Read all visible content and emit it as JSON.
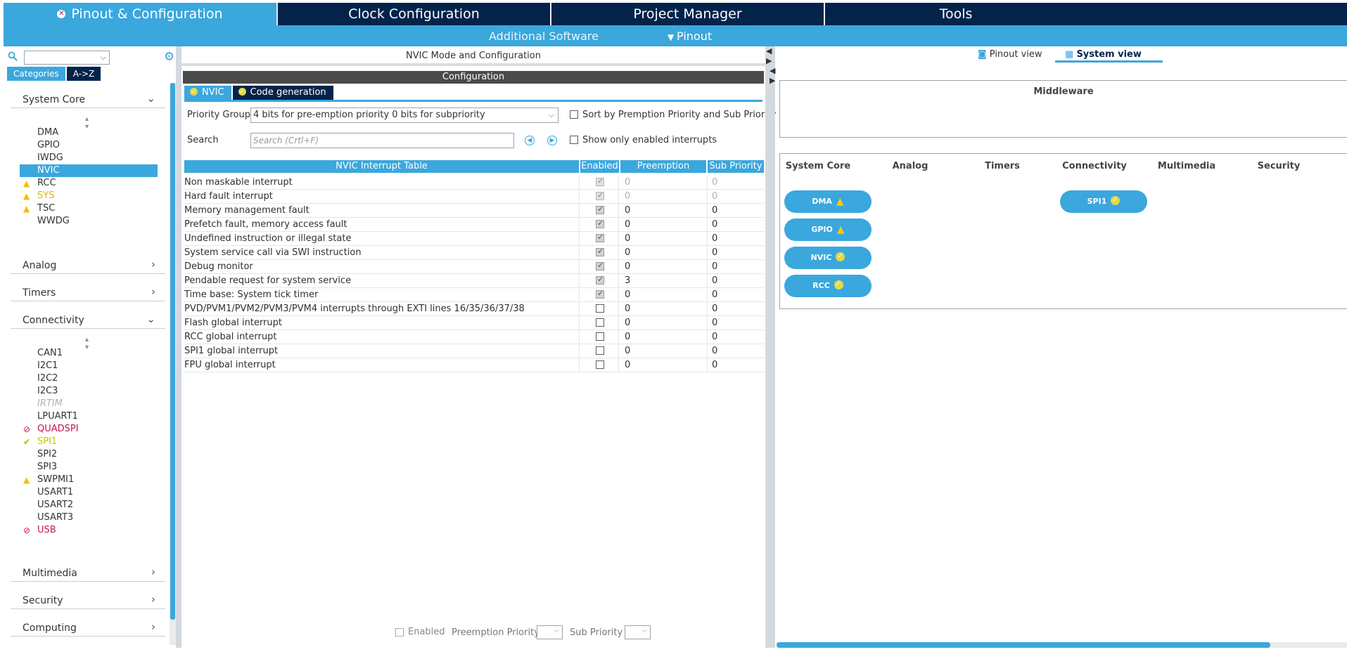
{
  "top_tabs": [
    {
      "label": "Pinout & Configuration",
      "active": true
    },
    {
      "label": "Clock Configuration"
    },
    {
      "label": "Project Manager"
    },
    {
      "label": "Tools"
    }
  ],
  "sub_menu": {
    "additional_software": "Additional Software",
    "pinout": "Pinout"
  },
  "left": {
    "category_tabs": [
      "Categories",
      "A->Z"
    ],
    "categories": {
      "system_core": "System Core",
      "analog": "Analog",
      "timers": "Timers",
      "connectivity": "Connectivity",
      "multimedia": "Multimedia",
      "security": "Security",
      "computing": "Computing"
    },
    "system_core_items": [
      "DMA",
      "GPIO",
      "IWDG",
      "NVIC",
      "RCC",
      "SYS",
      "TSC",
      "WWDG"
    ],
    "connectivity_items": [
      "CAN1",
      "I2C1",
      "I2C2",
      "I2C3",
      "IRTIM",
      "LPUART1",
      "QUADSPI",
      "SPI1",
      "SPI2",
      "SPI3",
      "SWPMI1",
      "USART1",
      "USART2",
      "USART3",
      "USB"
    ]
  },
  "middle": {
    "title": "NVIC Mode and Configuration",
    "config_header": "Configuration",
    "tabs": [
      "NVIC",
      "Code generation"
    ],
    "priority_group_label": "Priority Group",
    "priority_group_value": "4 bits for pre-emption priority 0 bits for subpriority",
    "sort_label": "Sort by Premption Priority and Sub Priority",
    "search_label": "Search",
    "search_placeholder": "Search (Crtl+F)",
    "show_enabled_label": "Show only enabled interrupts",
    "table_headers": [
      "NVIC Interrupt Table",
      "Enabled",
      "Preemption Priority",
      "Sub Priority"
    ],
    "rows": [
      {
        "name": "Non maskable interrupt",
        "enabled": true,
        "locked": true,
        "pre": "0",
        "sub": "0"
      },
      {
        "name": "Hard fault interrupt",
        "enabled": true,
        "locked": true,
        "pre": "0",
        "sub": "0"
      },
      {
        "name": "Memory management fault",
        "enabled": true,
        "locked": false,
        "pre": "0",
        "sub": "0"
      },
      {
        "name": "Prefetch fault, memory access fault",
        "enabled": true,
        "locked": false,
        "pre": "0",
        "sub": "0"
      },
      {
        "name": "Undefined instruction or illegal state",
        "enabled": true,
        "locked": false,
        "pre": "0",
        "sub": "0"
      },
      {
        "name": "System service call via SWI instruction",
        "enabled": true,
        "locked": false,
        "pre": "0",
        "sub": "0"
      },
      {
        "name": "Debug monitor",
        "enabled": true,
        "locked": false,
        "pre": "0",
        "sub": "0"
      },
      {
        "name": "Pendable request for system service",
        "enabled": true,
        "locked": false,
        "pre": "3",
        "sub": "0"
      },
      {
        "name": "Time base: System tick timer",
        "enabled": true,
        "locked": false,
        "pre": "0",
        "sub": "0"
      },
      {
        "name": "PVD/PVM1/PVM2/PVM3/PVM4 interrupts through EXTI lines 16/35/36/37/38",
        "enabled": false,
        "locked": false,
        "pre": "0",
        "sub": "0"
      },
      {
        "name": "Flash global interrupt",
        "enabled": false,
        "locked": false,
        "pre": "0",
        "sub": "0"
      },
      {
        "name": "RCC global interrupt",
        "enabled": false,
        "locked": false,
        "pre": "0",
        "sub": "0"
      },
      {
        "name": "SPI1 global interrupt",
        "enabled": false,
        "locked": false,
        "pre": "0",
        "sub": "0"
      },
      {
        "name": "FPU global interrupt",
        "enabled": false,
        "locked": false,
        "pre": "0",
        "sub": "0"
      }
    ],
    "bottom": {
      "enabled": "Enabled",
      "preemption": "Preemption Priority",
      "sub": "Sub Priority"
    }
  },
  "right": {
    "view_tabs": [
      "Pinout view",
      "System view"
    ],
    "middleware": "Middleware",
    "columns": [
      "System Core",
      "Analog",
      "Timers",
      "Connectivity",
      "Multimedia",
      "Security"
    ],
    "system_core_pills": [
      "DMA",
      "GPIO",
      "NVIC",
      "RCC"
    ],
    "connectivity_pills": [
      "SPI1"
    ]
  },
  "colors": {
    "accent": "#3aa7dd",
    "dark": "#03234b",
    "warning": "#f2cd00",
    "disabled": "#c8135b",
    "ok": "#e3d94c"
  }
}
